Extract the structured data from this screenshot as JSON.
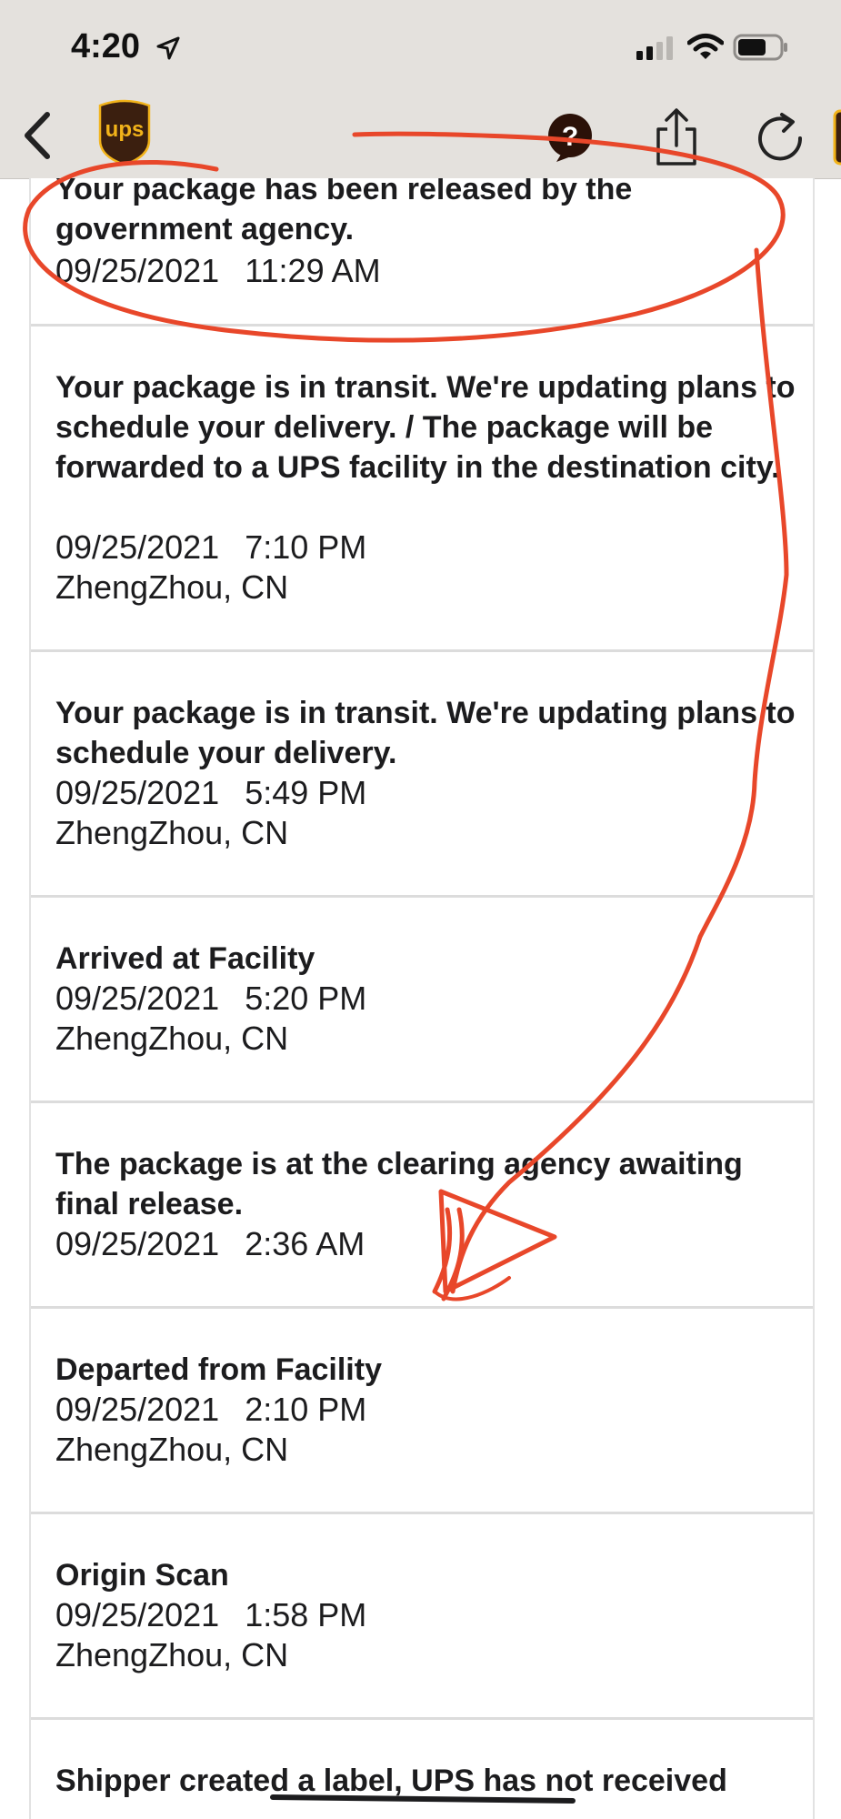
{
  "status_bar": {
    "time": "4:20",
    "icons": [
      "location-arrow-icon",
      "cellular-signal-icon",
      "wifi-icon",
      "battery-icon"
    ]
  },
  "nav": {
    "logo_text": "ups",
    "help_glyph": "?",
    "icons": [
      "back-chevron-icon",
      "ups-logo",
      "help-icon",
      "share-icon",
      "refresh-icon"
    ]
  },
  "colors": {
    "ups_brown": "#3b1f0f",
    "ups_gold": "#f2b31a",
    "annotation_red": "#e8472a",
    "header_bg": "#e4e1dd"
  },
  "events": [
    {
      "description": "Your package has been released by the government agency.",
      "date": "09/25/2021",
      "time": "11:29 AM",
      "location": ""
    },
    {
      "description": "Your package is in transit. We're updating plans to schedule your delivery. / The package will be forwarded to a UPS facility in the destination city.",
      "date": "09/25/2021",
      "time": "7:10 PM",
      "location": "ZhengZhou, CN"
    },
    {
      "description": "Your package is in transit. We're updating plans to schedule your delivery.",
      "date": "09/25/2021",
      "time": "5:49 PM",
      "location": "ZhengZhou, CN"
    },
    {
      "description": "Arrived at Facility",
      "date": "09/25/2021",
      "time": "5:20 PM",
      "location": "ZhengZhou, CN"
    },
    {
      "description": "The package is at the clearing agency awaiting final release.",
      "date": "09/25/2021",
      "time": "2:36 AM",
      "location": ""
    },
    {
      "description": "Departed from Facility",
      "date": "09/25/2021",
      "time": "2:10 PM",
      "location": "ZhengZhou, CN"
    },
    {
      "description": "Origin Scan",
      "date": "09/25/2021",
      "time": "1:58 PM",
      "location": "ZhengZhou, CN"
    },
    {
      "description": "Shipper created a label, UPS has not received",
      "date": "",
      "time": "",
      "location": ""
    }
  ]
}
